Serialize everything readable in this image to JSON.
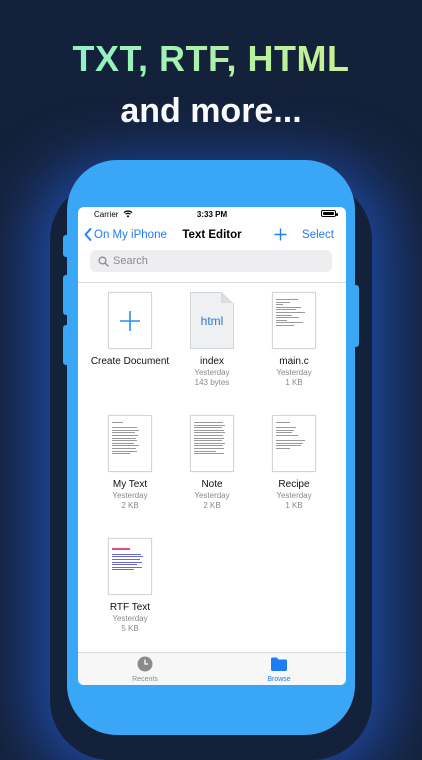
{
  "headline": "TXT, RTF, HTML",
  "subheadline": "and more...",
  "status": {
    "carrier": "Carrier",
    "time": "3:33 PM"
  },
  "nav": {
    "back_label": "On My iPhone",
    "title": "Text Editor",
    "add": "+",
    "select": "Select"
  },
  "search": {
    "placeholder": "Search"
  },
  "create_label": "Create Document",
  "files": [
    {
      "name": "index",
      "date": "Yesterday",
      "size": "143 bytes",
      "thumb": "html",
      "thumb_text": "html"
    },
    {
      "name": "main.c",
      "date": "Yesterday",
      "size": "1 KB",
      "thumb": "text"
    },
    {
      "name": "My Text",
      "date": "Yesterday",
      "size": "2 KB",
      "thumb": "text"
    },
    {
      "name": "Note",
      "date": "Yesterday",
      "size": "2 KB",
      "thumb": "text"
    },
    {
      "name": "Recipe",
      "date": "Yesterday",
      "size": "1 KB",
      "thumb": "text"
    },
    {
      "name": "RTF Text",
      "date": "Yesterday",
      "size": "5 KB",
      "thumb": "rtf"
    }
  ],
  "tabs": [
    {
      "label": "Recents",
      "icon": "clock-icon",
      "active": false
    },
    {
      "label": "Browse",
      "icon": "folder-icon",
      "active": true
    }
  ],
  "colors": {
    "accent": "#1e7cf5",
    "phone": "#3aa6f6",
    "background": "#14213a"
  }
}
